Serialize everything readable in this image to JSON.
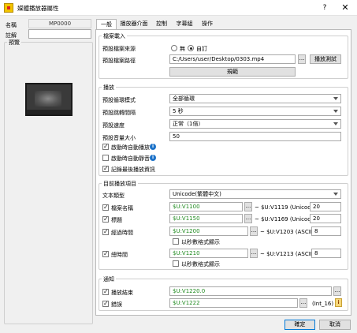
{
  "window": {
    "title": "媒體播放器屬性",
    "help": "?",
    "close": "✕"
  },
  "left": {
    "name_label": "名稱",
    "name_value": "MP0000",
    "note_label": "註解",
    "note_value": "",
    "preview_label": "預覽"
  },
  "tabs": [
    "一般",
    "播放器介面",
    "控制",
    "字幕組",
    "操作"
  ],
  "file_load": {
    "title": "檔案載入",
    "source_label": "預設檔案來源",
    "radio_none": "無",
    "radio_custom": "自訂",
    "path_label": "預設檔案路徑",
    "path_value": "C:/Users/user/Desktop/0303.mp4",
    "browse": "...",
    "test_button": "播放測試",
    "rule_button": "規範"
  },
  "playback": {
    "title": "播放",
    "loop_label": "預設循環模式",
    "loop_value": "全部循環",
    "skip_label": "預設跳轉間隔",
    "skip_value": "5 秒",
    "speed_label": "預設速度",
    "speed_value": "正常（1倍）",
    "volume_label": "預設音量大小",
    "volume_value": "50",
    "autoplay": "啟動時自動播放",
    "automute": "啟動時自動靜音",
    "remember": "記錄最後播放資訊"
  },
  "current": {
    "title": "目前播放項目",
    "text_type_label": "文本類型",
    "text_type_value": "Unicode(繁體中文)",
    "rows": [
      {
        "label": "檔案名稱",
        "address": "$U:V1100",
        "range": "~ $U:V1119 (Unicode)",
        "size": "20"
      },
      {
        "label": "標題",
        "address": "$U:V1150",
        "range": "~ $U:V1169 (Unicode)",
        "size": "20"
      },
      {
        "label": "經過時間",
        "address": "$U:V1200",
        "range": "~ $U:V1203 (ASCII)",
        "size": "8"
      },
      {
        "label": "總時間",
        "address": "$U:V1210",
        "range": "~ $U:V1213 (ASCII)",
        "size": "8"
      }
    ],
    "seconds_format": "以秒數格式顯示"
  },
  "notify": {
    "title": "通知",
    "end_label": "播放結束",
    "end_value": "$U:V1220.0",
    "error_label": "錯誤",
    "error_value": "$U:V1222",
    "error_type": "(Int_16)"
  },
  "footer": {
    "ok": "確定",
    "cancel": "取消"
  },
  "colors": {
    "accent": "#0078d7",
    "address_text": "#1f8a1f",
    "info": "#1d72c8"
  }
}
